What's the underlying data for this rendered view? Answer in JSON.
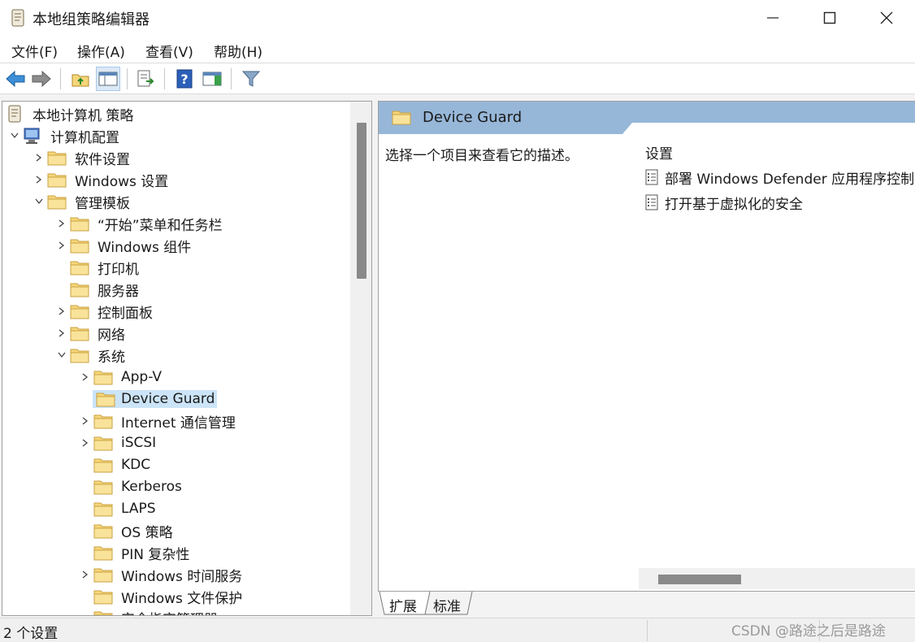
{
  "window": {
    "title": "本地组策略编辑器"
  },
  "menu": [
    "文件(F)",
    "操作(A)",
    "查看(V)",
    "帮助(H)"
  ],
  "toolbar": {
    "icons": [
      "back-arrow-icon",
      "forward-arrow-icon",
      "up-folder-icon",
      "show-hide-tree-icon",
      "export-list-icon",
      "help-icon",
      "show-hide-action-pane-icon",
      "filter-icon"
    ]
  },
  "tree": {
    "root": "本地计算机 策略",
    "computer_config": "计算机配置",
    "software_settings": "软件设置",
    "windows_settings": "Windows 设置",
    "admin_templates": "管理模板",
    "start_menu": "“开始”菜单和任务栏",
    "windows_components": "Windows 组件",
    "printers": "打印机",
    "server": "服务器",
    "control_panel": "控制面板",
    "network": "网络",
    "system": "系统",
    "app_v": "App-V",
    "device_guard": "Device Guard",
    "internet_comm": "Internet 通信管理",
    "iscsi": "iSCSI",
    "kdc": "KDC",
    "kerberos": "Kerberos",
    "laps": "LAPS",
    "os_policy": "OS 策略",
    "pin": "PIN 复杂性",
    "time_service": "Windows 时间服务",
    "file_protection": "Windows 文件保护",
    "last_partial": "安全指定管理器"
  },
  "right": {
    "header": "Device Guard",
    "description": "选择一个项目来查看它的描述。",
    "column_header": "设置",
    "items": [
      "部署 Windows Defender 应用程序控制",
      "打开基于虚拟化的安全"
    ]
  },
  "tabs": [
    "扩展",
    "标准"
  ],
  "status": {
    "text": "2 个设置",
    "watermark": "CSDN @路途之后是路途"
  },
  "colors": {
    "header_bg": "#97b7d8",
    "folder": "#f6d67a",
    "selection": "#cce4f7",
    "back_arrow": "#3c8fd6"
  }
}
